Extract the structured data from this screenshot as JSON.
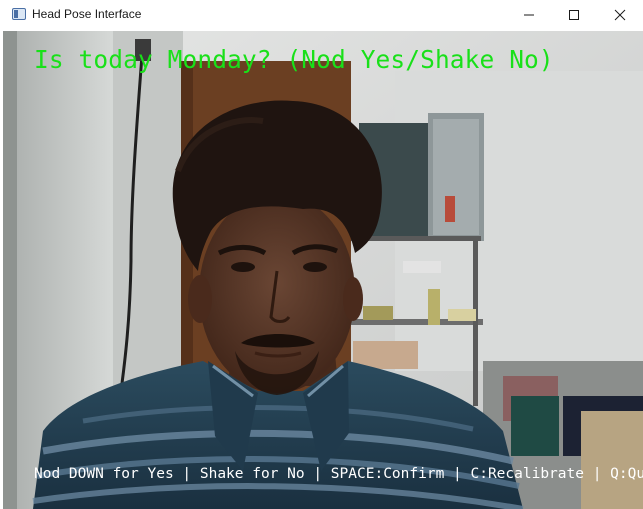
{
  "window": {
    "title": "Head Pose Interface",
    "app_icon": "window-app-icon",
    "controls": {
      "minimize_icon": "minimize-icon",
      "maximize_icon": "maximize-icon",
      "close_icon": "close-icon"
    }
  },
  "video": {
    "question": "Is today Monday? (Nod Yes/Shake No)",
    "instructions": "Nod DOWN for Yes | Shake for No | SPACE:Confirm | C:Recalibrate | Q:Quit",
    "colors": {
      "question": "#19e019",
      "instructions": "#ffffff"
    }
  }
}
